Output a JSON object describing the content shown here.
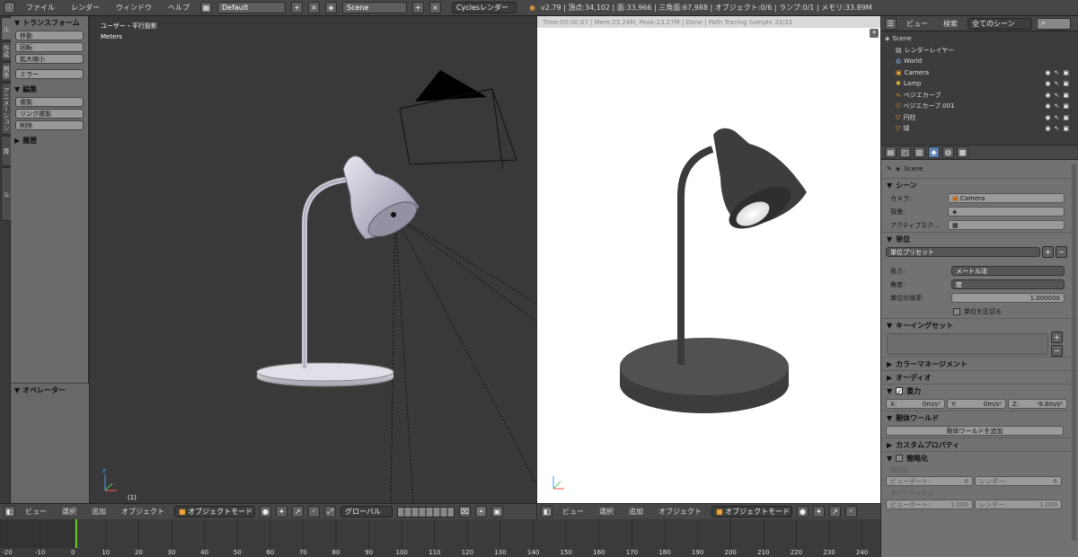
{
  "topbar": {
    "info_icon": "info-icon",
    "menus": [
      "ファイル",
      "レンダー",
      "ウィンドウ",
      "ヘルプ"
    ],
    "screen_layout": "Default",
    "scene": "Scene",
    "engine": "Cyclesレンダー",
    "stats": "v2.79 | 頂点:34,102 | 面:33,966 | 三角面:67,988 | オブジェクト:0/6 | ランプ:0/1 | メモリ:33.89M"
  },
  "left_tabs": [
    "ツール",
    "作成",
    "関係",
    "アニメーション",
    "物理演算",
    "グリースペンシル"
  ],
  "toolshelf": {
    "transform_title": "トランスフォーム",
    "transform_buttons": [
      "移動",
      "回転",
      "拡大縮小"
    ],
    "mirror_button": "ミラー",
    "edit_title": "編集",
    "edit_buttons": [
      "複製",
      "リンク複製",
      "削除"
    ],
    "history_title": "履歴",
    "operator_title": "オペレーター"
  },
  "viewport3d": {
    "view_label": "ユーザー・平行投影",
    "units_label": "Meters",
    "frame_label": "(1)"
  },
  "render_view": {
    "status": "Time:00:00.67 | Mem:23.24M, Peak:23.27M | Done | Path Tracing Sample 32/32"
  },
  "header3d_left": {
    "menus": [
      "ビュー",
      "選択",
      "追加",
      "オブジェクト"
    ],
    "mode": "オブジェクトモード",
    "orientation": "グローバル"
  },
  "header3d_right": {
    "menus": [
      "ビュー",
      "選択",
      "追加",
      "オブジェクト"
    ],
    "mode": "オブジェクトモード"
  },
  "timeline": {
    "ticks": [
      "-20",
      "-10",
      "0",
      "10",
      "20",
      "30",
      "40",
      "50",
      "60",
      "70",
      "80",
      "90",
      "100",
      "110",
      "120",
      "130",
      "140",
      "150",
      "160",
      "170",
      "180",
      "190",
      "200",
      "210",
      "220",
      "230",
      "240"
    ],
    "current_frame": 1
  },
  "outliner": {
    "menus": [
      "ビュー",
      "検索"
    ],
    "filter": "全てのシーン",
    "rows": [
      {
        "label": "Scene",
        "icon": "scene-icon",
        "indent": 0
      },
      {
        "label": "レンダーレイヤー",
        "icon": "render-layer-icon",
        "indent": 1
      },
      {
        "label": "World",
        "icon": "world-icon",
        "indent": 1
      },
      {
        "label": "Camera",
        "icon": "camera-icon",
        "indent": 1
      },
      {
        "label": "Lamp",
        "icon": "lamp-icon",
        "indent": 1
      },
      {
        "label": "ベジエカーブ",
        "icon": "curve-icon",
        "indent": 1
      },
      {
        "label": "ベジエカーブ.001",
        "icon": "mesh-icon",
        "indent": 1
      },
      {
        "label": "円柱",
        "icon": "mesh-icon",
        "indent": 1
      },
      {
        "label": "球",
        "icon": "mesh-icon",
        "indent": 1
      }
    ]
  },
  "properties": {
    "context": "Scene",
    "scene_section": "シーン",
    "camera_label": "カメラ:",
    "camera_value": "Camera",
    "background_label": "背景:",
    "active_clip_label": "アクティブなク...",
    "units_section": "単位",
    "unit_presets": "単位プリセット",
    "length_label": "長さ:",
    "length_value": "メートル法",
    "angle_label": "角度:",
    "angle_value": "度",
    "scale_label": "単位の倍率:",
    "scale_value": "1.000000",
    "separate_units": "単位を区切る",
    "keying_section": "キーイングセット",
    "color_mgmt_section": "カラーマネージメント",
    "audio_section": "オーディオ",
    "gravity_section": "重力",
    "gravity": [
      {
        "label": "X:",
        "value": "0m/s²"
      },
      {
        "label": "Y:",
        "value": "0m/s²"
      },
      {
        "label": "Z:",
        "value": "-9.8m/s²"
      }
    ],
    "rigid_world_section": "剛体ワールド",
    "add_rigid_world": "剛体ワールドを追加",
    "custom_props_section": "カスタムプロパティ",
    "simplify_section": "簡略化",
    "subdivision_label": "細分化",
    "viewport_label": "ビューポート:",
    "viewport_value": "6",
    "render_label": "レンダー:",
    "render_value": "6",
    "child_particles_label": "子パーティクル",
    "child_viewport_value": "1.000",
    "child_render_value": "1.000"
  }
}
